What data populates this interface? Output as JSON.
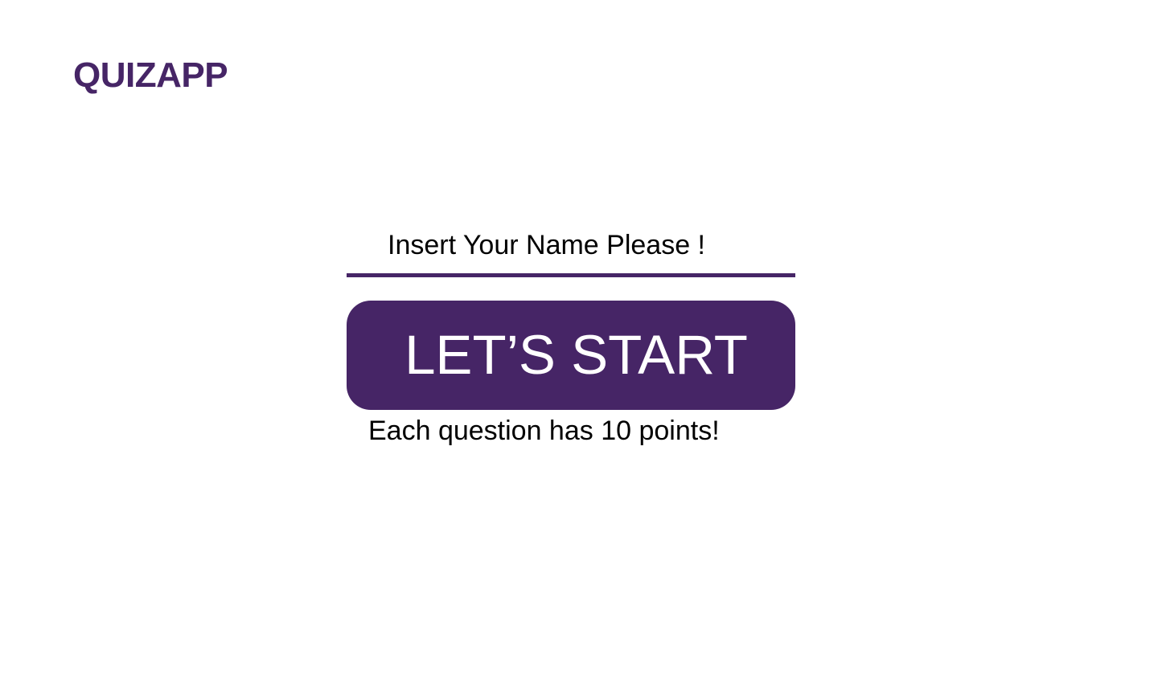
{
  "app": {
    "logo_text": "QUIZAPP",
    "brand_color": "#462566"
  },
  "form": {
    "name_input": {
      "value": "",
      "placeholder": "Insert Your Name Please !"
    },
    "start_button_label": "LET’S START",
    "hint_text": "Each question has 10 points!"
  }
}
